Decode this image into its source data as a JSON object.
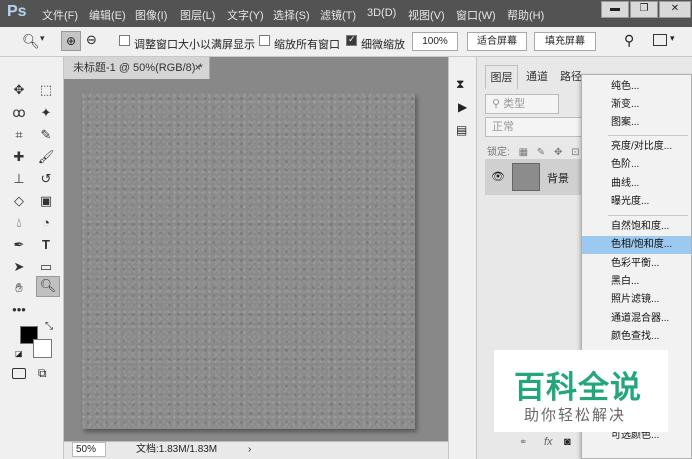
{
  "app": {
    "logo": "Ps"
  },
  "menubar": {
    "items": [
      "文件(F)",
      "编辑(E)",
      "图像(I)",
      "图层(L)",
      "文字(Y)",
      "选择(S)",
      "滤镜(T)",
      "3D(D)",
      "视图(V)",
      "窗口(W)",
      "帮助(H)"
    ]
  },
  "window_controls": {
    "minimize": "▬",
    "restore": "❐",
    "close": "✕"
  },
  "options_bar": {
    "resize_windows_label": "调整窗口大小以满屏显示",
    "resize_windows_checked": false,
    "zoom_all_label": "缩放所有窗口",
    "zoom_all_checked": false,
    "scrubby_zoom_label": "细微缩放",
    "scrubby_zoom_checked": true,
    "zoom_100_label": "100%",
    "fit_screen_label": "适合屏幕",
    "fill_screen_label": "填充屏幕"
  },
  "document": {
    "tab_title": "未标题-1 @ 50%(RGB/8) *",
    "status_zoom": "50%",
    "status_doc": "文档:1.83M/1.83M"
  },
  "panels": {
    "tabs": [
      "图层",
      "通道",
      "路径"
    ],
    "search_placeholder": "类型",
    "blend_mode": "正常",
    "lock_label": "锁定:",
    "layer_name": "背景"
  },
  "adjustment_menu": {
    "items": [
      "纯色...",
      "渐变...",
      "图案...",
      "亮度/对比度...",
      "色阶...",
      "曲线...",
      "曝光度...",
      "自然饱和度...",
      "色相/饱和度...",
      "色彩平衡...",
      "黑白...",
      "照片滤镜...",
      "通道混合器...",
      "颜色查找...",
      "可选颜色..."
    ],
    "highlighted_index": 8,
    "highlight_color": "#9bc9ef"
  },
  "watermark": {
    "title": "百科全说",
    "subtitle": "助你轻松解决",
    "color": "#24a67c"
  }
}
